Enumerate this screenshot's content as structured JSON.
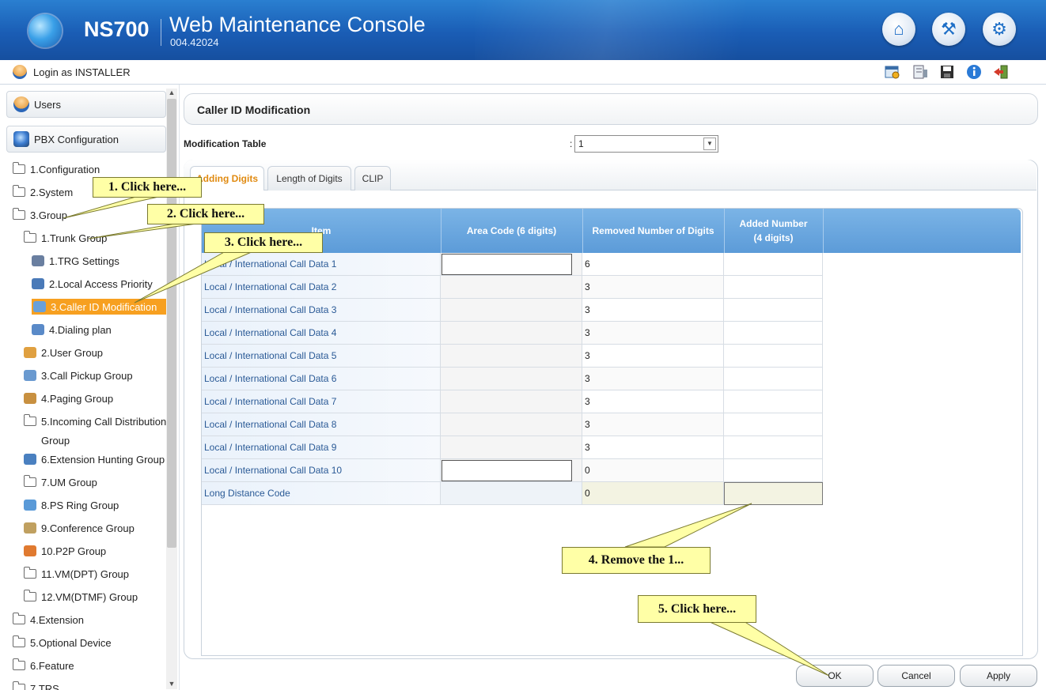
{
  "header": {
    "brand": "NS700",
    "title": "Web Maintenance Console",
    "version": "004.42024",
    "buttons": [
      {
        "name": "home-icon",
        "glyph": "⌂"
      },
      {
        "name": "wrench-icon",
        "glyph": "⚒"
      },
      {
        "name": "settings-icon",
        "glyph": "⚙"
      }
    ]
  },
  "login": {
    "text": "Login as INSTALLER",
    "toolbar_icons": [
      "schedule-icon",
      "phone-directory-icon",
      "save-icon",
      "info-icon",
      "logout-icon"
    ]
  },
  "sidebar": {
    "panels": [
      {
        "label": "Users",
        "icon": "users-icon"
      },
      {
        "label": "PBX Configuration",
        "icon": "pbx-configuration-icon"
      }
    ],
    "tree": [
      {
        "label": "1.Configuration",
        "level": 0,
        "icon": "folder-icon"
      },
      {
        "label": "2.System",
        "level": 0,
        "icon": "folder-icon"
      },
      {
        "label": "3.Group",
        "level": 0,
        "icon": "folder-open-icon"
      },
      {
        "label": "1.Trunk Group",
        "level": 1,
        "icon": "folder-open-icon"
      },
      {
        "label": "1.TRG Settings",
        "level": 2,
        "icon": "trg-settings-icon"
      },
      {
        "label": "2.Local Access Priority",
        "level": 2,
        "icon": "local-access-icon"
      },
      {
        "label": "3.Caller ID Modification",
        "level": 2,
        "icon": "caller-id-icon",
        "selected": true
      },
      {
        "label": "4.Dialing plan",
        "level": 2,
        "icon": "dialing-plan-icon"
      },
      {
        "label": "2.User Group",
        "level": 1,
        "icon": "user-group-icon"
      },
      {
        "label": "3.Call Pickup Group",
        "level": 1,
        "icon": "call-pickup-icon"
      },
      {
        "label": "4.Paging Group",
        "level": 1,
        "icon": "paging-icon"
      },
      {
        "label": "5.Incoming Call Distribution",
        "level": 1,
        "icon": "folder-icon"
      },
      {
        "label": "Group",
        "level": 1,
        "icon": "",
        "continuation": true
      },
      {
        "label": "6.Extension Hunting Group",
        "level": 1,
        "icon": "extension-hunting-icon"
      },
      {
        "label": "7.UM Group",
        "level": 1,
        "icon": "folder-icon"
      },
      {
        "label": "8.PS Ring Group",
        "level": 1,
        "icon": "ps-ring-icon"
      },
      {
        "label": "9.Conference Group",
        "level": 1,
        "icon": "conference-icon"
      },
      {
        "label": "10.P2P Group",
        "level": 1,
        "icon": "p2p-icon"
      },
      {
        "label": "11.VM(DPT) Group",
        "level": 1,
        "icon": "folder-icon"
      },
      {
        "label": "12.VM(DTMF) Group",
        "level": 1,
        "icon": "folder-icon"
      },
      {
        "label": "4.Extension",
        "level": 0,
        "icon": "folder-icon"
      },
      {
        "label": "5.Optional Device",
        "level": 0,
        "icon": "folder-icon"
      },
      {
        "label": "6.Feature",
        "level": 0,
        "icon": "folder-icon"
      },
      {
        "label": "7.TRS",
        "level": 0,
        "icon": "folder-icon"
      }
    ]
  },
  "main": {
    "title": "Caller ID Modification",
    "modification_table": {
      "label": "Modification Table",
      "colon": ":",
      "value": "1"
    },
    "tabs": [
      {
        "label": "Adding Digits",
        "active": true
      },
      {
        "label": "Length of Digits",
        "active": false
      },
      {
        "label": "CLIP",
        "active": false
      }
    ],
    "table": {
      "headers": [
        "Item",
        "Area Code (6 digits)",
        "Removed Number of Digits",
        "Added Number\n(4 digits)"
      ],
      "rows": [
        {
          "item": "Local / International Call Data  1",
          "area_input": true,
          "removed": "6",
          "added": ""
        },
        {
          "item": "Local / International Call Data  2",
          "area_input": false,
          "removed": "3",
          "added": ""
        },
        {
          "item": "Local / International Call Data  3",
          "area_input": false,
          "removed": "3",
          "added": ""
        },
        {
          "item": "Local / International Call Data  4",
          "area_input": false,
          "removed": "3",
          "added": ""
        },
        {
          "item": "Local / International Call Data  5",
          "area_input": false,
          "removed": "3",
          "added": ""
        },
        {
          "item": "Local / International Call Data  6",
          "area_input": false,
          "removed": "3",
          "added": ""
        },
        {
          "item": "Local / International Call Data  7",
          "area_input": false,
          "removed": "3",
          "added": ""
        },
        {
          "item": "Local / International Call Data  8",
          "area_input": false,
          "removed": "3",
          "added": ""
        },
        {
          "item": "Local / International Call Data  9",
          "area_input": false,
          "removed": "3",
          "added": ""
        },
        {
          "item": "Local / International Call Data  10",
          "area_input": true,
          "removed": "0",
          "added": ""
        },
        {
          "item": "Long Distance Code",
          "area_input": false,
          "removed": "0",
          "added": "",
          "long_distance": true
        }
      ]
    },
    "buttons": {
      "ok": "OK",
      "cancel": "Cancel",
      "apply": "Apply"
    }
  },
  "callouts": [
    {
      "text": "1. Click here..."
    },
    {
      "text": "2. Click here..."
    },
    {
      "text": "3. Click here..."
    },
    {
      "text": "4. Remove the 1..."
    },
    {
      "text": "5. Click here..."
    }
  ],
  "colors": {
    "header_blue": "#1a5db5",
    "selected_orange": "#f7a020",
    "table_header_blue": "#5c9bd8",
    "callout_yellow": "#ffffa6"
  }
}
